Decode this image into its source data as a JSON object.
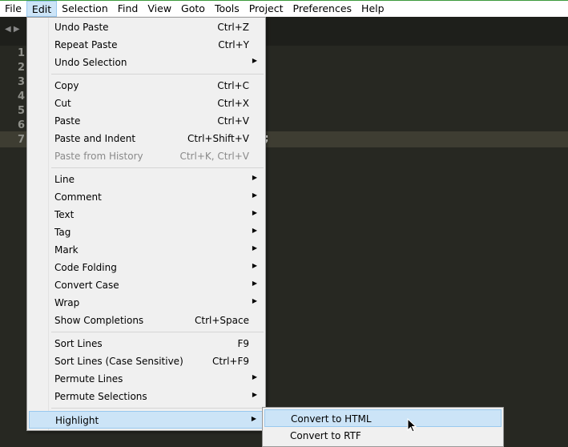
{
  "menubar": [
    "File",
    "Edit",
    "Selection",
    "Find",
    "View",
    "Goto",
    "Tools",
    "Project",
    "Preferences",
    "Help"
  ],
  "editor": {
    "line_numbers": [
      "1",
      "2",
      "3",
      "4",
      "5",
      "6",
      "7"
    ],
    "visible_text": ";"
  },
  "edit_menu": [
    {
      "label": "Undo Paste",
      "shortcut": "Ctrl+Z"
    },
    {
      "label": "Repeat Paste",
      "shortcut": "Ctrl+Y"
    },
    {
      "label": "Undo Selection",
      "submenu": true
    },
    {
      "sep": true
    },
    {
      "label": "Copy",
      "shortcut": "Ctrl+C"
    },
    {
      "label": "Cut",
      "shortcut": "Ctrl+X"
    },
    {
      "label": "Paste",
      "shortcut": "Ctrl+V"
    },
    {
      "label": "Paste and Indent",
      "shortcut": "Ctrl+Shift+V"
    },
    {
      "label": "Paste from History",
      "shortcut": "Ctrl+K, Ctrl+V",
      "disabled": true
    },
    {
      "sep": true
    },
    {
      "label": "Line",
      "submenu": true
    },
    {
      "label": "Comment",
      "submenu": true
    },
    {
      "label": "Text",
      "submenu": true
    },
    {
      "label": "Tag",
      "submenu": true
    },
    {
      "label": "Mark",
      "submenu": true
    },
    {
      "label": "Code Folding",
      "submenu": true
    },
    {
      "label": "Convert Case",
      "submenu": true
    },
    {
      "label": "Wrap",
      "submenu": true
    },
    {
      "label": "Show Completions",
      "shortcut": "Ctrl+Space"
    },
    {
      "sep": true
    },
    {
      "label": "Sort Lines",
      "shortcut": "F9"
    },
    {
      "label": "Sort Lines (Case Sensitive)",
      "shortcut": "Ctrl+F9"
    },
    {
      "label": "Permute Lines",
      "submenu": true
    },
    {
      "label": "Permute Selections",
      "submenu": true
    },
    {
      "sep": true
    },
    {
      "label": "Highlight",
      "submenu": true,
      "selected": true
    }
  ],
  "highlight_submenu": [
    {
      "label": "Convert to HTML",
      "selected": true
    },
    {
      "label": "Convert to RTF"
    }
  ]
}
